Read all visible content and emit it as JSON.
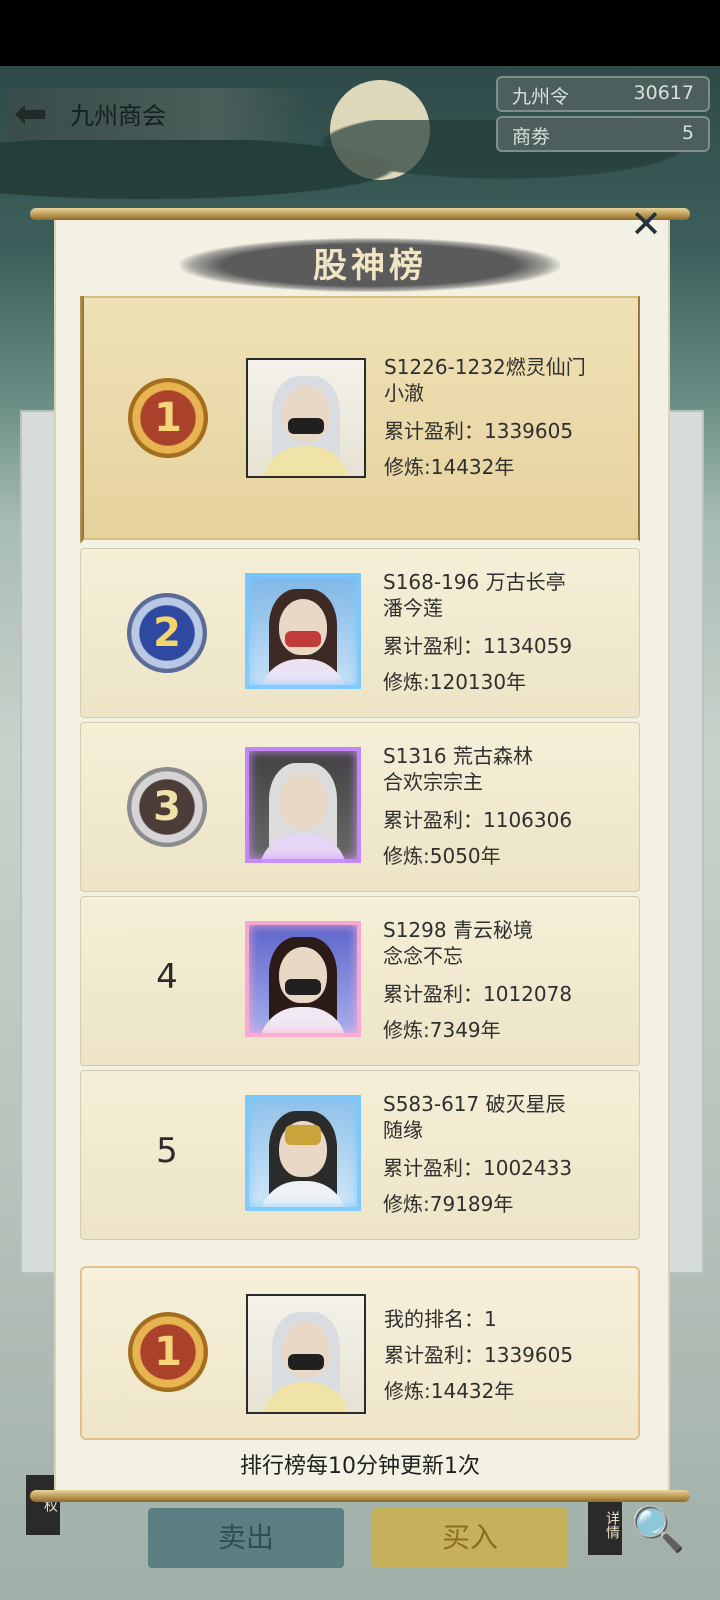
{
  "header": {
    "title": "九州商会",
    "currencies": [
      {
        "label": "九州令",
        "value": "30617"
      },
      {
        "label": "商劵",
        "value": "5"
      }
    ]
  },
  "modal": {
    "title": "股神榜",
    "footer_note": "排行榜每10分钟更新1次",
    "rows": [
      {
        "rank": "1",
        "server_line": "S1226-1232燃灵仙门",
        "name": "小澈",
        "profit_label": "累计盈利：",
        "profit": "1339605",
        "cult_label": "修炼:",
        "cult": "14432年"
      },
      {
        "rank": "2",
        "server_line": "S168-196 万古长亭",
        "name": "潘今莲",
        "profit_label": "累计盈利：",
        "profit": "1134059",
        "cult_label": "修炼:",
        "cult": "120130年"
      },
      {
        "rank": "3",
        "server_line": "S1316 荒古森林",
        "name": "合欢宗宗主",
        "profit_label": "累计盈利：",
        "profit": "1106306",
        "cult_label": "修炼:",
        "cult": "5050年"
      },
      {
        "rank": "4",
        "server_line": "S1298 青云秘境",
        "name": "念念不忘",
        "profit_label": "累计盈利：",
        "profit": "1012078",
        "cult_label": "修炼:",
        "cult": "7349年"
      },
      {
        "rank": "5",
        "server_line": "S583-617 破灭星辰",
        "name": "随缘",
        "profit_label": "累计盈利：",
        "profit": "1002433",
        "cult_label": "修炼:",
        "cult": "79189年"
      }
    ],
    "my_rank": {
      "rank": "1",
      "rank_label": "我的排名：",
      "rank_value": "1",
      "profit_label": "累计盈利：",
      "profit": "1339605",
      "cult_label": "修炼:",
      "cult": "14432年"
    }
  },
  "bottom": {
    "sell_label": "卖出",
    "buy_label": "买入",
    "left_badge": "权",
    "right_badge": "详情"
  },
  "colors": {
    "gold_accent": "#d9bf7c",
    "panel_bg": "#f3f1e4",
    "sell_btn": "#5c7f84",
    "buy_btn": "#c7b05b"
  },
  "icons": [
    "back-arrow-icon",
    "close-icon",
    "search-icon",
    "rank-medal-icon"
  ]
}
